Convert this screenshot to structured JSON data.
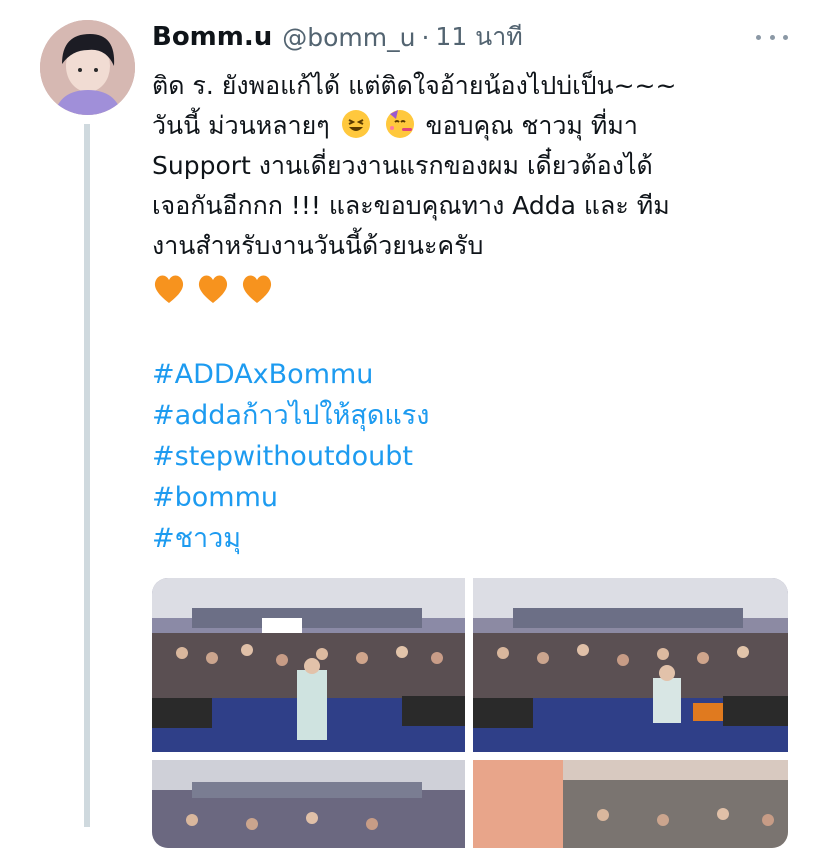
{
  "tweet": {
    "display_name": "Bomm.u",
    "handle": "@bomm_u",
    "separator": "·",
    "time": "11 นาที",
    "lines": [
      "ติด ร. ยังพอแก้ได้ แต่ติดใจอ้ายน้องไปบ่เป็น~~~",
      "วันนี้ ม่วนหลายๆ",
      "ขอบคุณ ชาวมุ ที่มา",
      "Support งานเดี่ยวงานแรกของผม เดี๋ยวต้องได้",
      "เจอกันอีกกก !!! และขอบคุณทาง Adda และ ทีม",
      "งานสำหรับงานวันนี้ด้วยนะครับ"
    ],
    "hashtags": [
      "#ADDAxBommu",
      "#addaก้าวไปให้สุดแรง",
      "#stepwithoutdoubt",
      "#bommu",
      "#ชาวมุ"
    ],
    "emoji": [
      "grinning-squinting-face-emoji",
      "partying-face-emoji",
      "orange-heart-emoji"
    ]
  },
  "colors": {
    "link": "#1d9bf0",
    "secondary_text": "#536471",
    "heart": "#f7931e"
  }
}
